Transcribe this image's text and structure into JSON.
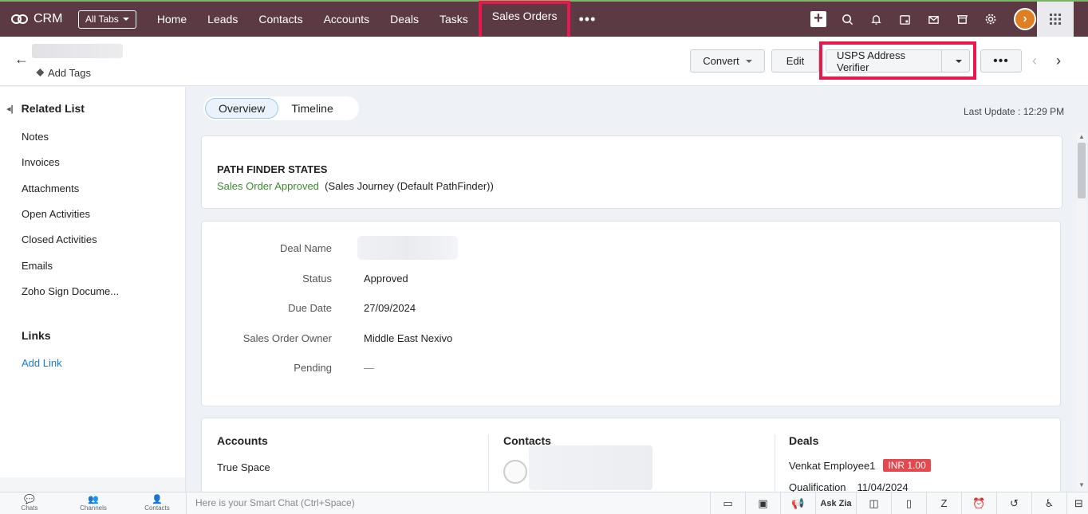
{
  "topnav": {
    "brand": "CRM",
    "all_tabs": "All Tabs",
    "tabs": [
      "Home",
      "Leads",
      "Contacts",
      "Accounts",
      "Deals",
      "Tasks",
      "Sales Orders"
    ],
    "active_tab": "Sales Orders",
    "more": "•••",
    "icons": [
      "plus-icon",
      "search-icon",
      "bell-icon",
      "calendar-icon",
      "mail-icon",
      "store-icon",
      "gear-icon",
      "avatar",
      "apps-grid-icon"
    ],
    "nav_bg": "#5c3a43"
  },
  "header": {
    "add_tags": "Add Tags",
    "convert": "Convert",
    "edit": "Edit",
    "usps": "USPS Address Verifier",
    "more": "•••",
    "highlight_color": "#e8174c"
  },
  "sidebar": {
    "related_list": "Related List",
    "items": [
      "Notes",
      "Invoices",
      "Attachments",
      "Open Activities",
      "Closed Activities",
      "Emails",
      "Zoho Sign Docume..."
    ],
    "links_title": "Links",
    "add_link": "Add Link"
  },
  "main": {
    "tabs": [
      "Overview",
      "Timeline"
    ],
    "active_tab": "Overview",
    "last_update": "Last Update : 12:29 PM",
    "path": {
      "title": "PATH FINDER STATES",
      "stage": "Sales Order Approved",
      "journey": "(Sales Journey (Default PathFinder))"
    },
    "fields": [
      {
        "label": "Deal Name",
        "value": ""
      },
      {
        "label": "Status",
        "value": "Approved"
      },
      {
        "label": "Due Date",
        "value": "27/09/2024"
      },
      {
        "label": "Sales Order Owner",
        "value": "Middle East Nexivo"
      },
      {
        "label": "Pending",
        "value": "—"
      }
    ],
    "related": {
      "accounts_title": "Accounts",
      "account_name": "True Space",
      "contacts_title": "Contacts",
      "deals_title": "Deals",
      "deal_name": "Venkat Employee1",
      "deal_amount": "INR 1.00",
      "deal_stage": "Qualification",
      "deal_date": "11/04/2024"
    }
  },
  "bottombar": {
    "apps": [
      "Chats",
      "Channels",
      "Contacts"
    ],
    "smart_chat_placeholder": "Here is your Smart Chat (Ctrl+Space)",
    "ask_zia": "Ask Zia"
  }
}
